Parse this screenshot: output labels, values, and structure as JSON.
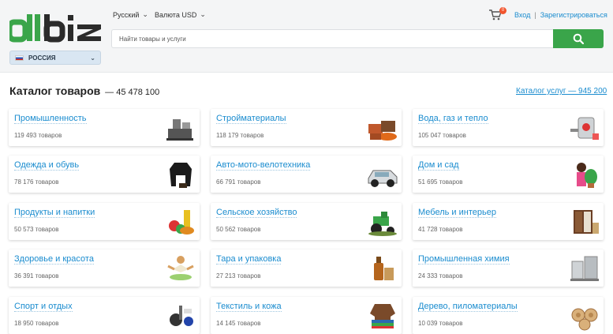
{
  "header": {
    "logo_text": "allbiz",
    "language_label": "Русский",
    "currency_label": "Валюта USD",
    "cart_count": "0",
    "login_label": "Вход",
    "register_label": "Зарегистрироваться",
    "region_label": "РОССИЯ",
    "search_placeholder": "Найти товары и услуги"
  },
  "catalog": {
    "title": "Каталог товаров",
    "count": "— 45 478 100",
    "services_link": "Каталог услуг — 945 200",
    "categories": [
      {
        "name": "Промышленность",
        "count": "119 493 товаров",
        "icon": "industry-machine-icon"
      },
      {
        "name": "Стройматериалы",
        "count": "118 179 товаров",
        "icon": "building-materials-icon"
      },
      {
        "name": "Вода, газ и тепло",
        "count": "105 047 товаров",
        "icon": "boiler-icon"
      },
      {
        "name": "Одежда и обувь",
        "count": "78 176 товаров",
        "icon": "jacket-icon"
      },
      {
        "name": "Авто-мото-велотехника",
        "count": "66 791 товаров",
        "icon": "car-icon"
      },
      {
        "name": "Дом и сад",
        "count": "51 695 товаров",
        "icon": "woman-plant-icon"
      },
      {
        "name": "Продукты и напитки",
        "count": "50 573 товаров",
        "icon": "groceries-icon"
      },
      {
        "name": "Сельское хозяйство",
        "count": "50 562 товаров",
        "icon": "tractor-icon"
      },
      {
        "name": "Мебель и интерьер",
        "count": "41 728 товаров",
        "icon": "wardrobe-icon"
      },
      {
        "name": "Здоровье и красота",
        "count": "36 391 товаров",
        "icon": "yoga-woman-icon"
      },
      {
        "name": "Тара и упаковка",
        "count": "27 213 товаров",
        "icon": "bottle-bag-icon"
      },
      {
        "name": "Промышленная химия",
        "count": "24 333 товаров",
        "icon": "chemical-tanks-icon"
      },
      {
        "name": "Спорт и отдых",
        "count": "18 950 товаров",
        "icon": "sports-gear-icon"
      },
      {
        "name": "Текстиль и кожа",
        "count": "14 145 товаров",
        "icon": "leather-textile-icon"
      },
      {
        "name": "Дерево, пиломатериалы",
        "count": "10 039 товаров",
        "icon": "wood-logs-icon"
      }
    ]
  },
  "colors": {
    "accent_green": "#3aa54a",
    "link_blue": "#1a8ccf",
    "badge_orange": "#f2542d"
  }
}
